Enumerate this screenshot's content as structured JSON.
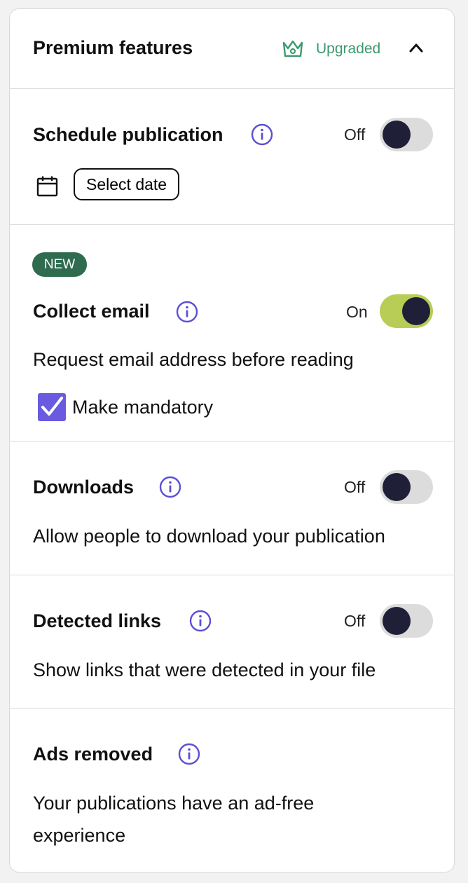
{
  "header": {
    "title": "Premium features",
    "status_label": "Upgraded",
    "status_icon": "crown-icon",
    "collapse_icon": "chevron-up-icon"
  },
  "schedule": {
    "title": "Schedule publication",
    "toggle_state": "Off",
    "toggle_on": false,
    "date_button_label": "Select date"
  },
  "collect_email": {
    "badge": "NEW",
    "title": "Collect email",
    "toggle_state": "On",
    "toggle_on": true,
    "description": "Request email address before reading",
    "checkbox_label": "Make mandatory",
    "checkbox_checked": true
  },
  "downloads": {
    "title": "Downloads",
    "toggle_state": "Off",
    "toggle_on": false,
    "description": "Allow people to download your publication"
  },
  "detected_links": {
    "title": "Detected links",
    "toggle_state": "Off",
    "toggle_on": false,
    "description": "Show links that were detected in your file"
  },
  "ads_removed": {
    "title": "Ads removed",
    "description_line1": "Your publications have an ad-free",
    "description_line2": "experience"
  },
  "colors": {
    "accent_green": "#3c9a6f",
    "badge_green": "#2e6b4f",
    "toggle_on": "#b8cd55",
    "info_purple": "#5b4fd6",
    "checkbox_purple": "#6a5ae0"
  }
}
